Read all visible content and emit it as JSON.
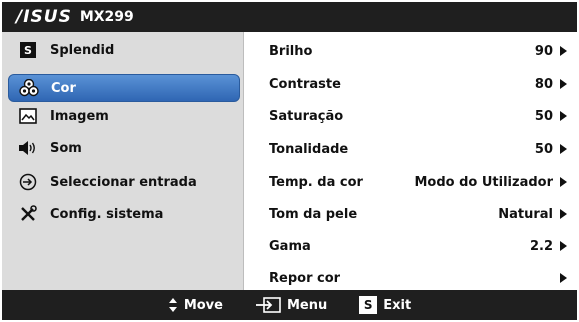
{
  "header": {
    "brand": "/ISUS",
    "model": "MX299"
  },
  "sidebar": {
    "items": [
      {
        "label": "Splendid",
        "icon": "splendid-s-icon"
      },
      {
        "label": "Cor",
        "icon": "color-palette-icon",
        "active": true
      },
      {
        "label": "Imagem",
        "icon": "image-icon"
      },
      {
        "label": "Som",
        "icon": "speaker-icon"
      },
      {
        "label": "Seleccionar entrada",
        "icon": "input-select-icon"
      },
      {
        "label": "Config. sistema",
        "icon": "tools-icon"
      }
    ]
  },
  "settings": {
    "rows": [
      {
        "label": "Brilho",
        "value": "90"
      },
      {
        "label": "Contraste",
        "value": "80"
      },
      {
        "label": "Saturação",
        "value": "50"
      },
      {
        "label": "Tonalidade",
        "value": "50"
      },
      {
        "label": "Temp. da cor",
        "value": "Modo do Utilizador"
      },
      {
        "label": "Tom da pele",
        "value": "Natural"
      },
      {
        "label": "Gama",
        "value": "2.2"
      },
      {
        "label": "Repor cor",
        "value": ""
      }
    ]
  },
  "footer": {
    "move": "Move",
    "menu": "Menu",
    "exit": "Exit",
    "exit_key": "S"
  },
  "colors": {
    "bar": "#1f1f1f",
    "sidebar": "#dcdcdc",
    "accent": "#3d74c2"
  }
}
